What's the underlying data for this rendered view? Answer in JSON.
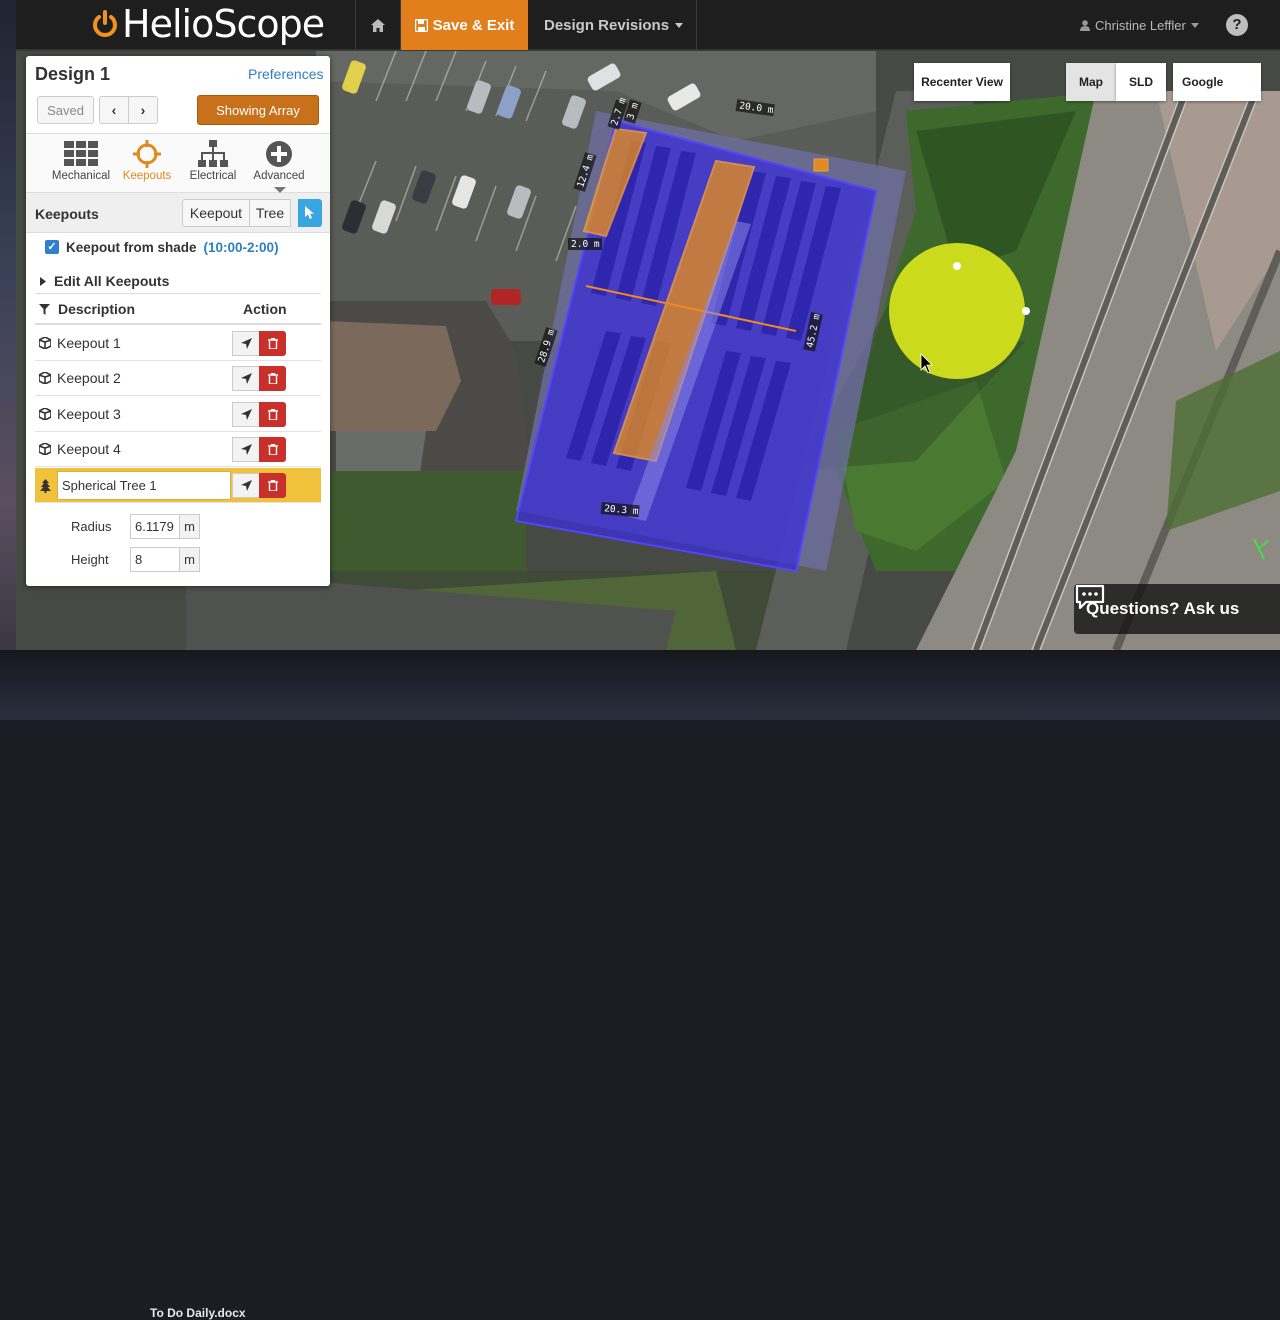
{
  "app": {
    "logo_text": "HelioScope",
    "save_exit_label": "Save & Exit",
    "design_revisions_label": "Design Revisions",
    "user_name": "Christine Leffler",
    "help_label": "?"
  },
  "panel": {
    "design_title": "Design 1",
    "preferences_label": "Preferences",
    "saved_label": "Saved",
    "showing_label": "Showing Array",
    "tabs": [
      {
        "label": "Mechanical",
        "icon": "grid-icon"
      },
      {
        "label": "Keepouts",
        "icon": "keepout-icon"
      },
      {
        "label": "Electrical",
        "icon": "electrical-tree-icon"
      },
      {
        "label": "Advanced",
        "icon": "plus-circle-icon"
      }
    ],
    "section_title": "Keepouts",
    "seg_keepout": "Keepout",
    "seg_tree": "Tree",
    "shade_label": "Keepout from shade",
    "shade_time": "(10:00-2:00)",
    "edit_all": "Edit All Keepouts",
    "col_description": "Description",
    "col_action": "Action",
    "keepouts": [
      {
        "label": "Keepout 1"
      },
      {
        "label": "Keepout 2"
      },
      {
        "label": "Keepout 3"
      },
      {
        "label": "Keepout 4"
      }
    ],
    "selected_tree": "Spherical Tree 1",
    "radius_label": "Radius",
    "radius_value": "6.1179",
    "radius_unit": "m",
    "height_label": "Height",
    "height_value": "8",
    "height_unit": "m"
  },
  "map": {
    "recenter_label": "Recenter View",
    "map_label": "Map",
    "sld_label": "SLD",
    "google_label": "Google",
    "questions_label": "Questions? Ask us",
    "dimensions": [
      "20.0 m",
      "12.4 m",
      "2.0 m",
      "28.9 m",
      "45.2 m",
      "20.3 m",
      "2.7 m",
      "3 m"
    ]
  },
  "desktop": {
    "file_label": "To Do Daily.docx"
  },
  "colors": {
    "accent_orange": "#e07f1b",
    "array_blue": "#3b2fd6",
    "tree_yellow": "#d4e21c",
    "delete_red": "#c9302c"
  }
}
